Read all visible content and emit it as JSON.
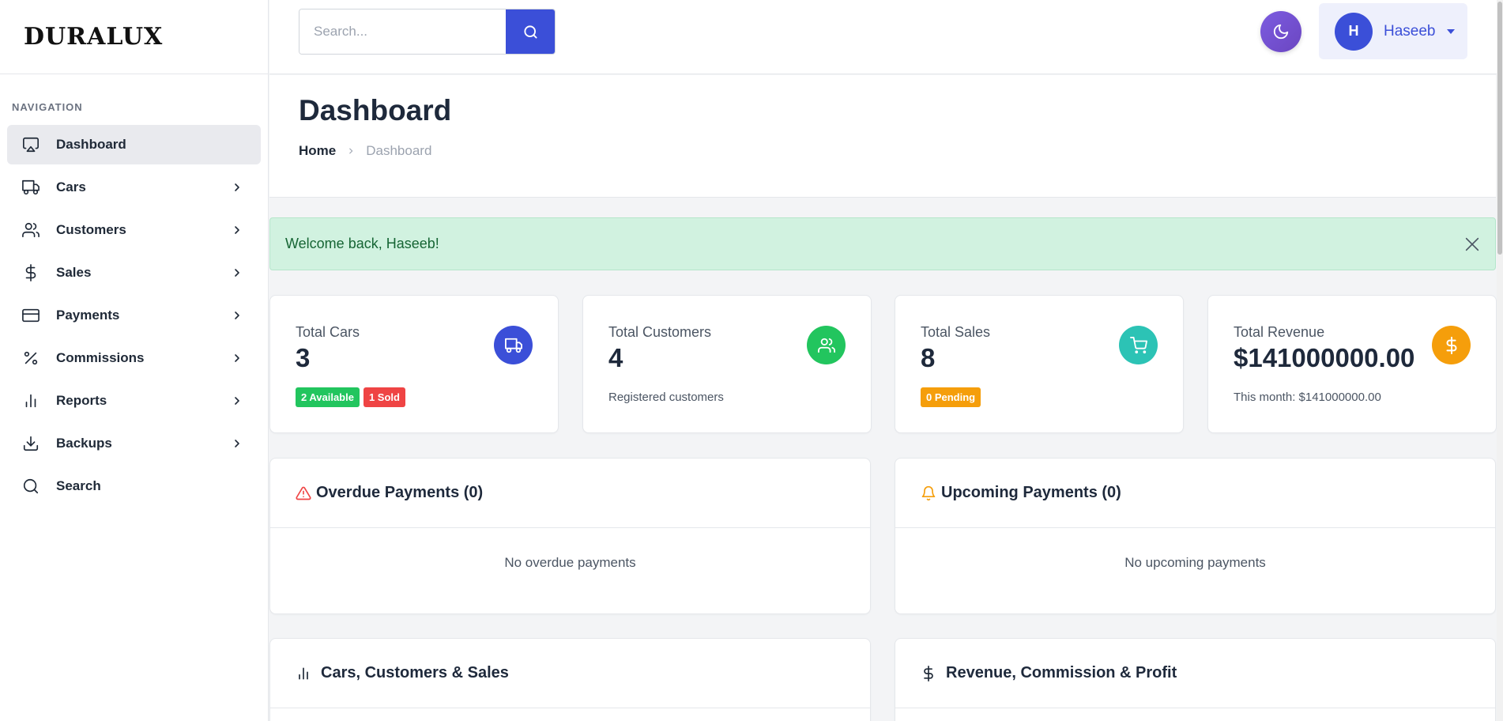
{
  "brand": {
    "logo_text": "DURALUX"
  },
  "sidebar": {
    "heading": "NAVIGATION",
    "items": [
      {
        "label": "Dashboard",
        "icon": "monitor-icon",
        "active": true,
        "has_children": false
      },
      {
        "label": "Cars",
        "icon": "truck-icon",
        "active": false,
        "has_children": true
      },
      {
        "label": "Customers",
        "icon": "users-icon",
        "active": false,
        "has_children": true
      },
      {
        "label": "Sales",
        "icon": "dollar-icon",
        "active": false,
        "has_children": true
      },
      {
        "label": "Payments",
        "icon": "credit-card-icon",
        "active": false,
        "has_children": true
      },
      {
        "label": "Commissions",
        "icon": "percent-icon",
        "active": false,
        "has_children": true
      },
      {
        "label": "Reports",
        "icon": "bar-chart-icon",
        "active": false,
        "has_children": true
      },
      {
        "label": "Backups",
        "icon": "download-icon",
        "active": false,
        "has_children": true
      },
      {
        "label": "Search",
        "icon": "search-icon",
        "active": false,
        "has_children": false
      }
    ]
  },
  "topbar": {
    "search_placeholder": "Search...",
    "user": {
      "initial": "H",
      "name": "Haseeb"
    }
  },
  "header": {
    "title": "Dashboard",
    "breadcrumb": {
      "home": "Home",
      "current": "Dashboard"
    }
  },
  "alert": {
    "message": "Welcome back, Haseeb!"
  },
  "stats": {
    "cars": {
      "title": "Total Cars",
      "value": "3",
      "badge_available": "2 Available",
      "badge_sold": "1 Sold",
      "color": "#3b4fd8"
    },
    "customers": {
      "title": "Total Customers",
      "value": "4",
      "sub": "Registered customers",
      "color": "#22c55e"
    },
    "sales": {
      "title": "Total Sales",
      "value": "8",
      "badge_pending": "0 Pending",
      "color": "#2cc3b5"
    },
    "revenue": {
      "title": "Total Revenue",
      "value": "$141000000.00",
      "sub": "This month: $141000000.00",
      "color": "#f59e0b"
    }
  },
  "payments": {
    "overdue": {
      "title": "Overdue Payments (0)",
      "empty": "No overdue payments"
    },
    "upcoming": {
      "title": "Upcoming Payments (0)",
      "empty": "No upcoming payments"
    }
  },
  "charts": {
    "left_title": "Cars, Customers & Sales",
    "right_title": "Revenue, Commission & Profit"
  },
  "colors": {
    "primary": "#3b4fd8",
    "success": "#22c55e",
    "danger": "#ef4444",
    "warning": "#f59e0b",
    "teal": "#2cc3b5",
    "alert_bg": "#d1f2e0"
  }
}
